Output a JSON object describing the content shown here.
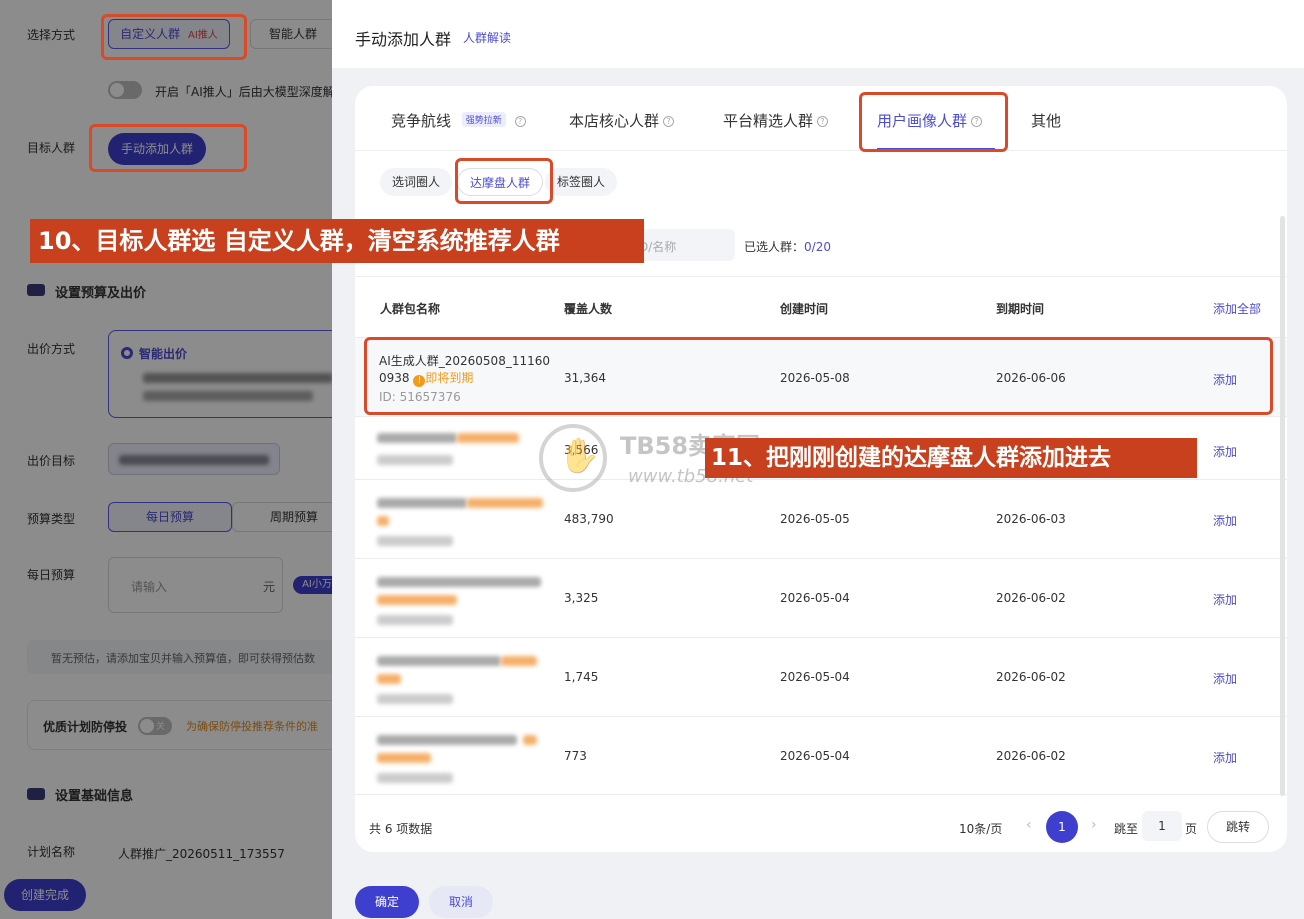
{
  "left_form": {
    "select_method_label": "选择方式",
    "custom_crowd": "自定义人群",
    "ai_tag": "AI推人",
    "smart_crowd": "智能人群",
    "ai_toggle_text": "开启「AI推人」后由大模型深度解",
    "target_crowd_label": "目标人群",
    "manual_add_button": "手动添加人群",
    "budget_section": "设置预算及出价",
    "bid_method_label": "出价方式",
    "smart_bid": "智能出价",
    "bid_target_label": "出价目标",
    "budget_type_label": "预算类型",
    "daily_budget_btn": "每日预算",
    "period_budget_btn": "周期预算",
    "daily_budget_label": "每日预算",
    "budget_placeholder": "请输入",
    "yuan": "元",
    "ai_small": "AI小万",
    "no_estimate": "暂无预估，请添加宝贝并输入预算值，即可获得预估数",
    "anti_stop_label": "优质计划防停投",
    "anti_stop_toggle": "关",
    "anti_stop_note": "为确保防停投推荐条件的准",
    "basic_section": "设置基础信息",
    "plan_name_label": "计划名称",
    "plan_name_value": "人群推广_20260511_173557",
    "create_button": "创建完成"
  },
  "drawer": {
    "title": "手动添加人群",
    "title_link": "人群解读",
    "tabs": [
      {
        "label": "竞争航线",
        "badge": "强势拉新"
      },
      {
        "label": "本店核心人群"
      },
      {
        "label": "平台精选人群"
      },
      {
        "label": "用户画像人群"
      },
      {
        "label": "其他"
      }
    ],
    "subtabs": [
      "选词圈人",
      "达摩盘人群",
      "标签圈人"
    ],
    "search_placeholder": "D/名称",
    "selected_label": "已选人群：",
    "selected_value": "0/20",
    "columns": [
      "人群包名称",
      "覆盖人数",
      "创建时间",
      "到期时间"
    ],
    "add_all": "添加全部",
    "rows": [
      {
        "name": "AI生成人群_20260508_111600938",
        "name_line1": "AI生成人群_20260508_11160",
        "name_line2": "0938",
        "warn": "即将到期",
        "id": "ID: 51657376",
        "coverage": "31,364",
        "created": "2026-05-08",
        "expire": "2026-06-06",
        "action": "添加"
      },
      {
        "coverage": "3,566",
        "created": "",
        "expire": "",
        "action": "添加"
      },
      {
        "coverage": "483,790",
        "created": "2026-05-05",
        "expire": "2026-06-03",
        "action": "添加"
      },
      {
        "coverage": "3,325",
        "created": "2026-05-04",
        "expire": "2026-06-02",
        "action": "添加"
      },
      {
        "coverage": "1,745",
        "created": "2026-05-04",
        "expire": "2026-06-02",
        "action": "添加"
      },
      {
        "coverage": "773",
        "created": "2026-05-04",
        "expire": "2026-06-02",
        "action": "添加"
      }
    ],
    "total": "共 6 项数据",
    "page_size": "10条/页",
    "current_page": "1",
    "goto_label": "跳至",
    "goto_value": "1",
    "page_unit": "页",
    "jump_button": "跳转",
    "ok_button": "确定",
    "cancel_button": "取消"
  },
  "annotations": {
    "step10": "10、目标人群选 自定义人群，清空系统推荐人群",
    "step11": "11、把刚刚创建的达摩盘人群添加进去"
  },
  "watermark": {
    "name": "TB58卖家网",
    "url": "www.tb58.net"
  },
  "colors": {
    "accent": "#4b4bd6",
    "highlight": "#d94a2a",
    "banner": "#c8401e",
    "warn": "#f29b1b"
  }
}
